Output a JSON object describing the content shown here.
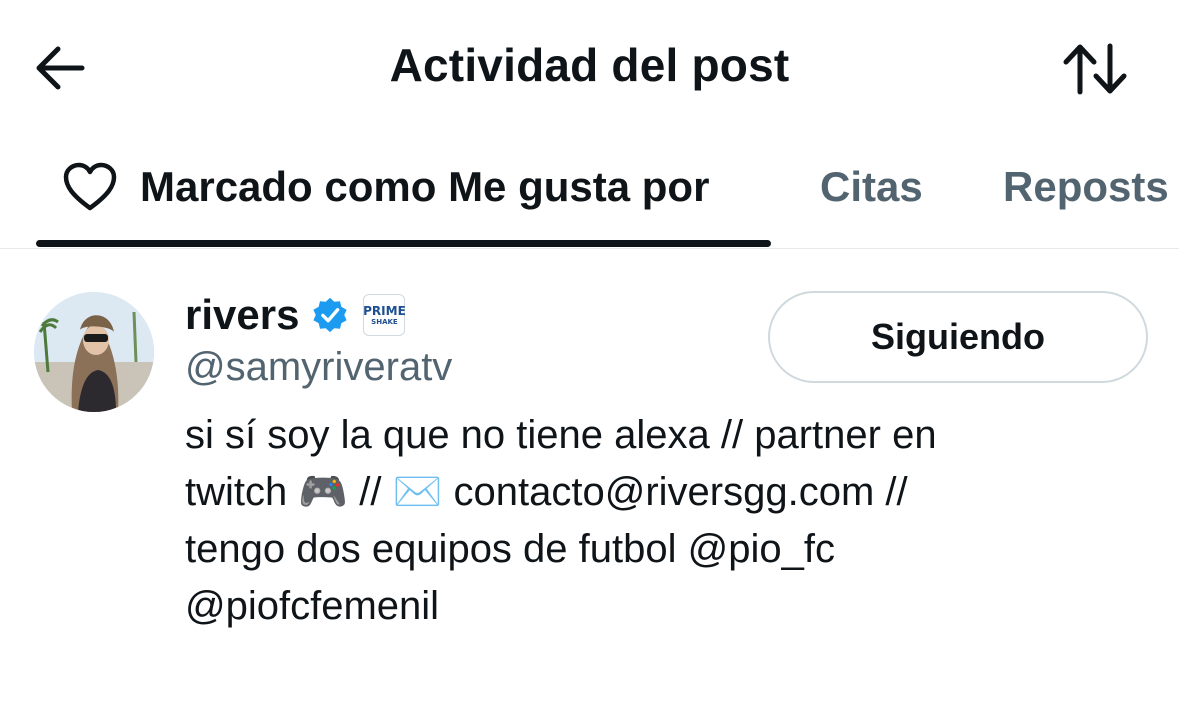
{
  "header": {
    "back_icon": "arrow-left-icon",
    "title": "Actividad del post",
    "sort_icon": "sort-arrows-icon"
  },
  "tabs": [
    {
      "label": "Marcado como Me gusta por",
      "icon": "heart-icon",
      "active": true
    },
    {
      "label": "Citas",
      "active": false
    },
    {
      "label": "Reposts",
      "active": false
    }
  ],
  "user": {
    "display_name": "rivers",
    "verified_icon": "verified-badge-icon",
    "affiliate_badge": {
      "line1": "PRIME",
      "line2": "SHAKE"
    },
    "handle": "@samyriveratv",
    "follow_label": "Siguiendo",
    "bio_lines": [
      "si sí soy la que no tiene alexa // partner en",
      "twitch 🎮 // ✉️ contacto@riversgg.com //",
      "tengo dos equipos de futbol @pio_fc",
      "@piofcfemenil"
    ]
  },
  "colors": {
    "text": "#0f1419",
    "muted": "#536471",
    "verified": "#1d9bf0",
    "border": "#cfd9de"
  }
}
